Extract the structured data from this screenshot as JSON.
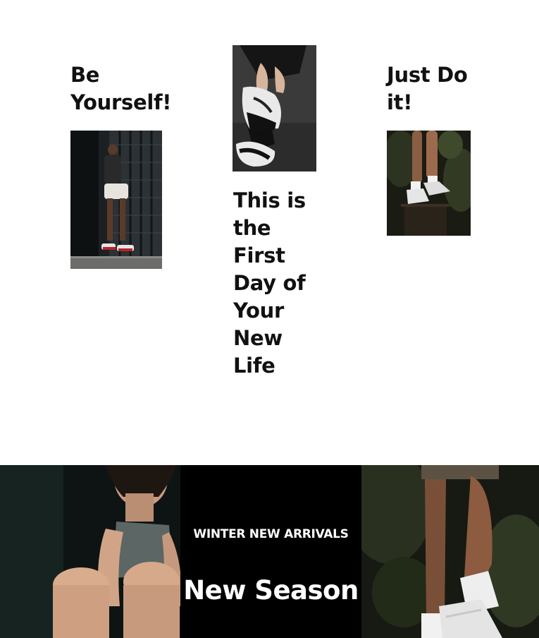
{
  "collage": {
    "left_heading": "Be Yourself!",
    "right_heading": "Just Do it!",
    "middle_heading": "This is the First Day of Your New Life",
    "images": {
      "left": "man-standing-on-ledge-photo",
      "middle": "hand-tying-sneaker-photo",
      "right": "legs-white-sneakers-photo"
    }
  },
  "banner": {
    "eyebrow": "WINTER NEW ARRIVALS",
    "title": "New Season",
    "images": {
      "left": "woman-sitting-fitness-photo",
      "right": "legs-white-socks-sneakers-photo"
    }
  }
}
